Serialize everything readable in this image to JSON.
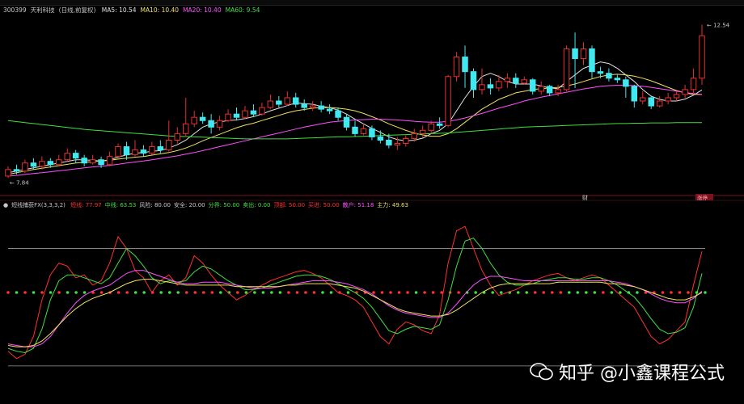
{
  "header": {
    "code": "300399",
    "name": "天利科技",
    "mode": "(日线,前复权)",
    "ma": [
      {
        "label": "MA5:",
        "value": "10.54",
        "color": "#e0e0e0"
      },
      {
        "label": "MA10:",
        "value": "10.40",
        "color": "#f0e060"
      },
      {
        "label": "MA20:",
        "value": "10.40",
        "color": "#ff50ff"
      },
      {
        "label": "MA60:",
        "value": "9.54",
        "color": "#40e040"
      }
    ]
  },
  "price_labels": {
    "high": "12.54",
    "low": "7.84"
  },
  "markers": {
    "cai": "财",
    "zhangting": "涨停"
  },
  "indicator": {
    "name": "短线捕获FX(3,3,3,2)",
    "items": [
      {
        "label": "短线:",
        "value": "77.97",
        "color": "#ff3030"
      },
      {
        "label": "中线:",
        "value": "63.53",
        "color": "#40e040"
      },
      {
        "label": "风险:",
        "value": "80.00",
        "color": "#c8c8c8"
      },
      {
        "label": "安全:",
        "value": "20.00",
        "color": "#c8c8c8"
      },
      {
        "label": "分界:",
        "value": "50.00",
        "color": "#40e040"
      },
      {
        "label": "卖出:",
        "value": "0.00",
        "color": "#40e040"
      },
      {
        "label": "顶部:",
        "value": "50.00",
        "color": "#ff3030"
      },
      {
        "label": "买进:",
        "value": "50.00",
        "color": "#ff3030"
      },
      {
        "label": "散户:",
        "value": "51.18",
        "color": "#ff50ff"
      },
      {
        "label": "主力:",
        "value": "49.63",
        "color": "#f0e060"
      }
    ]
  },
  "watermark": "知乎 @小鑫课程公式",
  "chart_data": {
    "type": "candlestick",
    "candles": [
      [
        7.9,
        8.1,
        7.84,
        8.2
      ],
      [
        8.1,
        8.05,
        7.95,
        8.25
      ],
      [
        8.05,
        8.3,
        8.0,
        8.4
      ],
      [
        8.3,
        8.2,
        8.1,
        8.45
      ],
      [
        8.2,
        8.35,
        8.1,
        8.5
      ],
      [
        8.35,
        8.25,
        8.15,
        8.45
      ],
      [
        8.25,
        8.4,
        8.2,
        8.55
      ],
      [
        8.4,
        8.6,
        8.35,
        8.75
      ],
      [
        8.6,
        8.45,
        8.3,
        8.7
      ],
      [
        8.45,
        8.3,
        8.2,
        8.55
      ],
      [
        8.3,
        8.4,
        8.25,
        8.55
      ],
      [
        8.4,
        8.25,
        8.15,
        8.5
      ],
      [
        8.25,
        8.5,
        8.2,
        8.65
      ],
      [
        8.5,
        8.8,
        8.45,
        8.9
      ],
      [
        8.8,
        8.55,
        8.4,
        8.95
      ],
      [
        8.55,
        8.7,
        8.5,
        9.0
      ],
      [
        8.7,
        8.6,
        8.5,
        8.85
      ],
      [
        8.6,
        8.8,
        8.55,
        8.95
      ],
      [
        8.8,
        8.7,
        8.6,
        9.0
      ],
      [
        8.7,
        9.0,
        8.65,
        9.6
      ],
      [
        9.0,
        9.2,
        8.9,
        9.4
      ],
      [
        9.2,
        9.5,
        9.1,
        10.3
      ],
      [
        9.5,
        9.7,
        9.4,
        9.9
      ],
      [
        9.7,
        9.6,
        9.5,
        9.85
      ],
      [
        9.6,
        9.4,
        9.2,
        9.8
      ],
      [
        9.4,
        9.6,
        9.3,
        9.75
      ],
      [
        9.6,
        9.8,
        9.55,
        9.95
      ],
      [
        9.8,
        9.7,
        9.6,
        10.0
      ],
      [
        9.7,
        9.9,
        9.65,
        10.05
      ],
      [
        9.9,
        9.8,
        9.7,
        10.1
      ],
      [
        9.8,
        10.0,
        9.75,
        10.15
      ],
      [
        10.0,
        10.2,
        9.95,
        10.4
      ],
      [
        10.2,
        10.1,
        10.0,
        10.35
      ],
      [
        10.1,
        10.3,
        10.05,
        10.5
      ],
      [
        10.3,
        10.1,
        10.0,
        10.45
      ],
      [
        10.1,
        10.0,
        9.9,
        10.25
      ],
      [
        10.0,
        10.05,
        9.9,
        10.2
      ],
      [
        10.05,
        9.95,
        9.85,
        10.2
      ],
      [
        9.95,
        9.9,
        9.8,
        10.1
      ],
      [
        9.9,
        9.7,
        9.6,
        10.0
      ],
      [
        9.7,
        9.4,
        9.3,
        9.8
      ],
      [
        9.4,
        9.2,
        9.1,
        9.6
      ],
      [
        9.2,
        9.35,
        9.15,
        9.5
      ],
      [
        9.35,
        9.1,
        9.0,
        9.45
      ],
      [
        9.1,
        9.0,
        8.9,
        9.3
      ],
      [
        9.0,
        8.85,
        8.75,
        9.2
      ],
      [
        8.85,
        8.9,
        8.7,
        9.1
      ],
      [
        8.9,
        9.05,
        8.8,
        9.15
      ],
      [
        9.05,
        9.2,
        8.95,
        9.35
      ],
      [
        9.2,
        9.3,
        9.1,
        9.45
      ],
      [
        9.3,
        9.5,
        9.2,
        9.6
      ],
      [
        9.5,
        9.45,
        9.35,
        9.7
      ],
      [
        9.45,
        10.95,
        9.4,
        11.0
      ],
      [
        10.95,
        11.55,
        10.8,
        11.7
      ],
      [
        11.55,
        11.1,
        10.6,
        11.9
      ],
      [
        11.1,
        10.55,
        10.3,
        11.2
      ],
      [
        10.55,
        10.7,
        10.4,
        11.2
      ],
      [
        10.7,
        10.6,
        10.4,
        10.9
      ],
      [
        10.6,
        10.8,
        10.5,
        11.0
      ],
      [
        10.8,
        10.9,
        10.6,
        11.05
      ],
      [
        10.9,
        10.75,
        10.6,
        11.05
      ],
      [
        10.75,
        10.85,
        10.7,
        10.95
      ],
      [
        10.85,
        10.5,
        10.4,
        10.9
      ],
      [
        10.5,
        10.65,
        10.4,
        10.8
      ],
      [
        10.65,
        10.45,
        10.35,
        10.7
      ],
      [
        10.45,
        10.55,
        10.35,
        10.7
      ],
      [
        10.55,
        11.8,
        10.5,
        11.9
      ],
      [
        11.8,
        11.5,
        10.6,
        12.3
      ],
      [
        11.5,
        11.8,
        11.3,
        12.0
      ],
      [
        11.8,
        11.1,
        10.9,
        11.9
      ],
      [
        11.1,
        11.05,
        10.9,
        11.25
      ],
      [
        11.05,
        10.9,
        10.8,
        11.2
      ],
      [
        10.9,
        10.85,
        10.75,
        11.0
      ],
      [
        10.85,
        10.65,
        10.3,
        10.95
      ],
      [
        10.65,
        10.2,
        10.0,
        10.7
      ],
      [
        10.2,
        10.3,
        10.1,
        10.5
      ],
      [
        10.3,
        10.05,
        9.95,
        10.35
      ],
      [
        10.05,
        10.2,
        10.0,
        10.35
      ],
      [
        10.2,
        10.3,
        10.1,
        10.45
      ],
      [
        10.3,
        10.4,
        10.2,
        10.5
      ],
      [
        10.4,
        10.55,
        10.3,
        10.7
      ],
      [
        10.55,
        10.9,
        10.4,
        11.2
      ],
      [
        10.9,
        12.2,
        10.7,
        12.54
      ]
    ],
    "ma_series": [
      {
        "name": "MA5",
        "color": "#e0e0e0",
        "values": [
          8.0,
          8.05,
          8.1,
          8.15,
          8.2,
          8.25,
          8.3,
          8.35,
          8.4,
          8.4,
          8.38,
          8.36,
          8.4,
          8.48,
          8.55,
          8.6,
          8.62,
          8.66,
          8.68,
          8.76,
          8.86,
          9.0,
          9.2,
          9.4,
          9.5,
          9.56,
          9.6,
          9.62,
          9.66,
          9.72,
          9.8,
          9.9,
          9.98,
          10.06,
          10.14,
          10.12,
          10.1,
          10.04,
          10.0,
          9.92,
          9.8,
          9.64,
          9.5,
          9.36,
          9.24,
          9.1,
          9.02,
          8.98,
          9.0,
          9.06,
          9.2,
          9.3,
          9.5,
          9.9,
          10.3,
          10.65,
          10.95,
          11.05,
          10.95,
          10.8,
          10.72,
          10.72,
          10.72,
          10.66,
          10.6,
          10.58,
          10.8,
          11.0,
          11.2,
          11.3,
          11.4,
          11.35,
          11.2,
          11.0,
          10.8,
          10.55,
          10.35,
          10.25,
          10.2,
          10.2,
          10.26,
          10.38,
          10.54
        ]
      },
      {
        "name": "MA10",
        "color": "#f0e060",
        "values": [
          7.95,
          8.0,
          8.05,
          8.1,
          8.14,
          8.18,
          8.22,
          8.26,
          8.3,
          8.32,
          8.34,
          8.36,
          8.38,
          8.42,
          8.45,
          8.48,
          8.5,
          8.54,
          8.58,
          8.62,
          8.68,
          8.76,
          8.86,
          8.98,
          9.08,
          9.18,
          9.28,
          9.38,
          9.46,
          9.52,
          9.6,
          9.68,
          9.76,
          9.84,
          9.9,
          9.94,
          9.98,
          10.0,
          10.0,
          9.98,
          9.95,
          9.9,
          9.82,
          9.72,
          9.62,
          9.5,
          9.4,
          9.3,
          9.22,
          9.16,
          9.12,
          9.12,
          9.2,
          9.35,
          9.55,
          9.75,
          9.95,
          10.1,
          10.25,
          10.35,
          10.45,
          10.5,
          10.55,
          10.58,
          10.6,
          10.62,
          10.66,
          10.72,
          10.8,
          10.88,
          10.95,
          11.0,
          11.02,
          11.0,
          10.96,
          10.9,
          10.82,
          10.72,
          10.62,
          10.52,
          10.45,
          10.4,
          10.4
        ]
      },
      {
        "name": "MA20",
        "color": "#ff50ff",
        "values": [
          7.9,
          7.92,
          7.95,
          7.98,
          8.0,
          8.03,
          8.06,
          8.09,
          8.12,
          8.15,
          8.18,
          8.2,
          8.23,
          8.26,
          8.3,
          8.33,
          8.36,
          8.4,
          8.44,
          8.48,
          8.52,
          8.57,
          8.62,
          8.68,
          8.74,
          8.8,
          8.86,
          8.92,
          8.98,
          9.04,
          9.1,
          9.16,
          9.22,
          9.28,
          9.34,
          9.4,
          9.45,
          9.5,
          9.55,
          9.58,
          9.6,
          9.62,
          9.63,
          9.64,
          9.64,
          9.63,
          9.62,
          9.6,
          9.58,
          9.56,
          9.55,
          9.55,
          9.58,
          9.62,
          9.68,
          9.75,
          9.82,
          9.9,
          9.98,
          10.05,
          10.12,
          10.2,
          10.26,
          10.32,
          10.37,
          10.42,
          10.47,
          10.52,
          10.57,
          10.61,
          10.65,
          10.67,
          10.68,
          10.68,
          10.67,
          10.65,
          10.62,
          10.58,
          10.54,
          10.5,
          10.46,
          10.43,
          10.4
        ]
      },
      {
        "name": "MA60",
        "color": "#40e040",
        "values": [
          9.6,
          9.57,
          9.54,
          9.51,
          9.48,
          9.45,
          9.42,
          9.39,
          9.36,
          9.33,
          9.31,
          9.29,
          9.27,
          9.25,
          9.23,
          9.21,
          9.19,
          9.17,
          9.15,
          9.13,
          9.12,
          9.11,
          9.1,
          9.09,
          9.08,
          9.07,
          9.06,
          9.05,
          9.04,
          9.04,
          9.04,
          9.04,
          9.04,
          9.04,
          9.05,
          9.06,
          9.07,
          9.08,
          9.09,
          9.1,
          9.1,
          9.11,
          9.12,
          9.13,
          9.14,
          9.15,
          9.16,
          9.17,
          9.18,
          9.19,
          9.2,
          9.21,
          9.22,
          9.24,
          9.26,
          9.28,
          9.3,
          9.32,
          9.34,
          9.36,
          9.38,
          9.4,
          9.41,
          9.42,
          9.43,
          9.44,
          9.45,
          9.46,
          9.47,
          9.48,
          9.49,
          9.5,
          9.51,
          9.51,
          9.52,
          9.52,
          9.53,
          9.53,
          9.53,
          9.54,
          9.54,
          9.54,
          9.54
        ]
      }
    ],
    "price_range": [
      7.6,
      12.9
    ],
    "indicator_series": [
      {
        "name": "短线",
        "color": "#ff3030",
        "values": [
          10,
          5,
          8,
          20,
          45,
          62,
          70,
          68,
          60,
          62,
          55,
          58,
          70,
          88,
          80,
          65,
          60,
          50,
          58,
          62,
          55,
          60,
          75,
          70,
          62,
          55,
          50,
          45,
          48,
          52,
          55,
          58,
          60,
          62,
          64,
          65,
          63,
          60,
          55,
          50,
          48,
          45,
          40,
          30,
          20,
          15,
          25,
          30,
          28,
          24,
          22,
          35,
          70,
          92,
          95,
          80,
          65,
          55,
          48,
          50,
          52,
          55,
          58,
          60,
          62,
          63,
          60,
          58,
          60,
          62,
          60,
          55,
          50,
          45,
          40,
          30,
          20,
          15,
          18,
          24,
          30,
          55,
          78
        ]
      },
      {
        "name": "中线",
        "color": "#40e040",
        "values": [
          12,
          10,
          9,
          12,
          25,
          45,
          58,
          62,
          62,
          60,
          58,
          56,
          60,
          70,
          80,
          75,
          68,
          60,
          56,
          58,
          57,
          58,
          64,
          68,
          66,
          62,
          58,
          55,
          52,
          52,
          53,
          55,
          57,
          59,
          61,
          62,
          62,
          61,
          59,
          56,
          53,
          50,
          46,
          40,
          32,
          24,
          22,
          25,
          27,
          26,
          25,
          28,
          45,
          68,
          85,
          87,
          80,
          70,
          62,
          57,
          55,
          55,
          56,
          58,
          59,
          60,
          60,
          59,
          59,
          60,
          60,
          58,
          55,
          51,
          47,
          40,
          32,
          25,
          22,
          23,
          26,
          40,
          63
        ]
      },
      {
        "name": "散户",
        "color": "#ff50ff",
        "values": [
          15,
          14,
          13,
          13,
          15,
          20,
          28,
          36,
          43,
          48,
          51,
          53,
          55,
          59,
          63,
          65,
          65,
          63,
          61,
          59,
          57,
          56,
          56,
          57,
          57,
          57,
          56,
          55,
          54,
          53,
          53,
          53,
          54,
          55,
          56,
          57,
          58,
          58,
          58,
          57,
          56,
          54,
          52,
          49,
          45,
          41,
          38,
          36,
          35,
          34,
          33,
          33,
          36,
          42,
          49,
          55,
          59,
          61,
          61,
          60,
          59,
          58,
          58,
          58,
          58,
          58,
          58,
          58,
          58,
          58,
          58,
          58,
          57,
          56,
          54,
          52,
          49,
          46,
          44,
          43,
          43,
          46,
          51
        ]
      },
      {
        "name": "主力",
        "color": "#f0e060",
        "values": [
          14,
          13,
          13,
          14,
          17,
          22,
          28,
          34,
          39,
          43,
          46,
          48,
          50,
          53,
          56,
          58,
          59,
          59,
          58,
          57,
          56,
          55,
          55,
          55,
          55,
          55,
          55,
          54,
          54,
          54,
          54,
          54,
          54,
          55,
          55,
          56,
          56,
          56,
          56,
          55,
          54,
          53,
          51,
          48,
          45,
          42,
          39,
          37,
          36,
          35,
          34,
          34,
          35,
          38,
          42,
          46,
          50,
          53,
          55,
          56,
          56,
          56,
          56,
          56,
          56,
          57,
          57,
          57,
          57,
          57,
          57,
          56,
          56,
          55,
          54,
          52,
          50,
          48,
          46,
          45,
          45,
          47,
          50
        ]
      }
    ],
    "indicator_range": [
      -5,
      105
    ],
    "levels": [
      80,
      50,
      0
    ],
    "dots": "rgrgrgrgggrrrrrggrgggrrrrggrgggggrrrrggrgrrrrrrrgrrrrrggggggggrrrrggggrggggrrrrrrgg"
  }
}
